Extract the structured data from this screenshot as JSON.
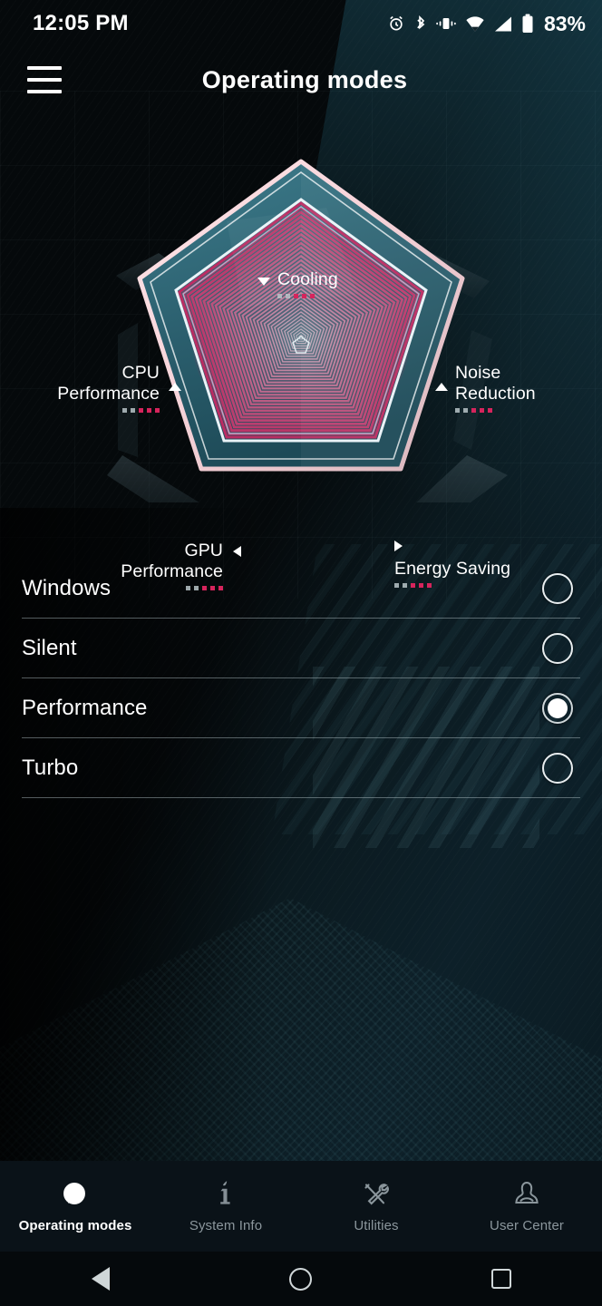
{
  "status_bar": {
    "time": "12:05 PM",
    "battery_percent": "83%",
    "icons": [
      "alarm-icon",
      "bluetooth-icon",
      "vibrate-icon",
      "wifi-icon",
      "cellular-signal-icon",
      "battery-icon"
    ]
  },
  "app_bar": {
    "menu_icon": "hamburger-menu-icon",
    "title": "Operating modes"
  },
  "chart_data": {
    "type": "radar",
    "title": "Operating modes radar",
    "categories": [
      "Cooling",
      "Noise Reduction",
      "Energy Saving",
      "GPU Performance",
      "CPU Performance"
    ],
    "series": [
      {
        "name": "Performance",
        "values": [
          5,
          4,
          3,
          5,
          5
        ]
      }
    ],
    "rating_max": 5,
    "axes": [
      {
        "id": "cooling",
        "line1": "Cooling",
        "line2": "",
        "marker": "triangle-down",
        "filled_dots": 3,
        "total_dots": 5
      },
      {
        "id": "noise-reduction",
        "line1": "Noise",
        "line2": "Reduction",
        "marker": "triangle-up",
        "filled_dots": 3,
        "total_dots": 5
      },
      {
        "id": "energy-saving",
        "line1": "Energy Saving",
        "line2": "",
        "marker": "triangle-right",
        "filled_dots": 3,
        "total_dots": 5
      },
      {
        "id": "gpu-performance",
        "line1": "GPU",
        "line2": "Performance",
        "marker": "triangle-left",
        "filled_dots": 3,
        "total_dots": 5
      },
      {
        "id": "cpu-performance",
        "line1": "CPU",
        "line2": "Performance",
        "marker": "triangle-up",
        "filled_dots": 3,
        "total_dots": 5
      }
    ],
    "colors": {
      "ring_outer": "#f2d6da",
      "fill_teal": "#2b5d6b",
      "accent_magenta": "#c42a63",
      "dot_active": "#d6245c",
      "dot_inactive": "#b9c4c8"
    }
  },
  "modes": {
    "selected": "Performance",
    "items": [
      {
        "label": "Windows",
        "selected": false
      },
      {
        "label": "Silent",
        "selected": false
      },
      {
        "label": "Performance",
        "selected": true
      },
      {
        "label": "Turbo",
        "selected": false
      }
    ]
  },
  "bottom_nav": {
    "active": "Operating modes",
    "items": [
      {
        "label": "Operating modes",
        "icon": "globe-swoosh-icon",
        "active": true
      },
      {
        "label": "System Info",
        "icon": "info-icon",
        "active": false
      },
      {
        "label": "Utilities",
        "icon": "tools-icon",
        "active": false
      },
      {
        "label": "User Center",
        "icon": "user-icon",
        "active": false
      }
    ]
  },
  "android_nav": {
    "back": "back-button",
    "home": "home-button",
    "recents": "recents-button"
  }
}
